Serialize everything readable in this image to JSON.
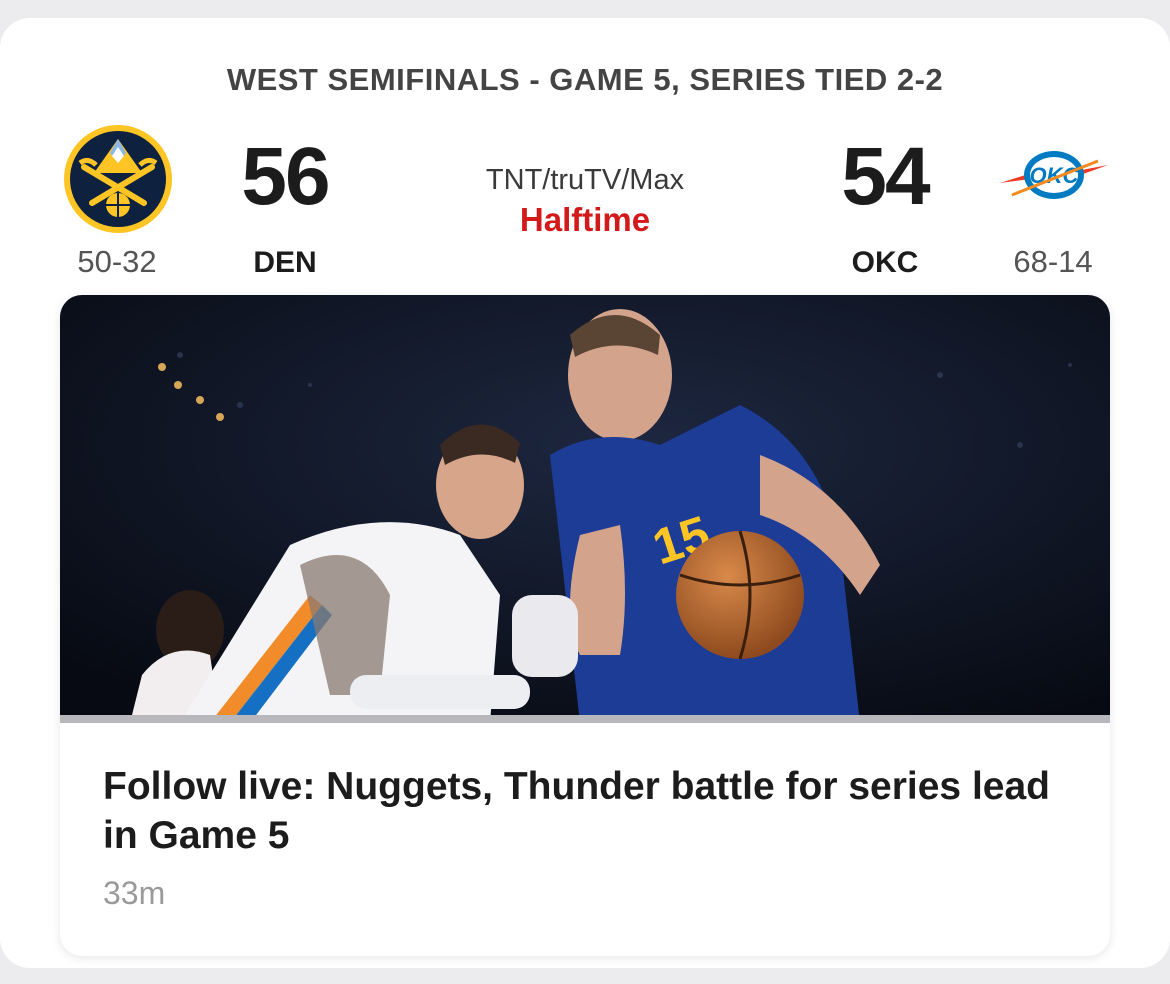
{
  "game": {
    "series_title": "WEST SEMIFINALS - GAME 5, SERIES TIED 2-2",
    "network": "TNT/truTV/Max",
    "status": "Halftime"
  },
  "home_team": {
    "abbr": "DEN",
    "score": "56",
    "record": "50-32",
    "logo_icon": "nuggets-logo-icon"
  },
  "away_team": {
    "abbr": "OKC",
    "score": "54",
    "record": "68-14",
    "logo_icon": "thunder-logo-icon",
    "logo_text": "OKC"
  },
  "story": {
    "headline": "Follow live: Nuggets, Thunder battle for series lead in Game 5",
    "timestamp": "33m",
    "image_icon": "game-action-photo"
  },
  "colors": {
    "status_red": "#d31a1a",
    "nuggets_navy": "#0e2240",
    "nuggets_gold": "#fec524",
    "thunder_blue": "#007ac1",
    "thunder_orange": "#ef3b24"
  }
}
